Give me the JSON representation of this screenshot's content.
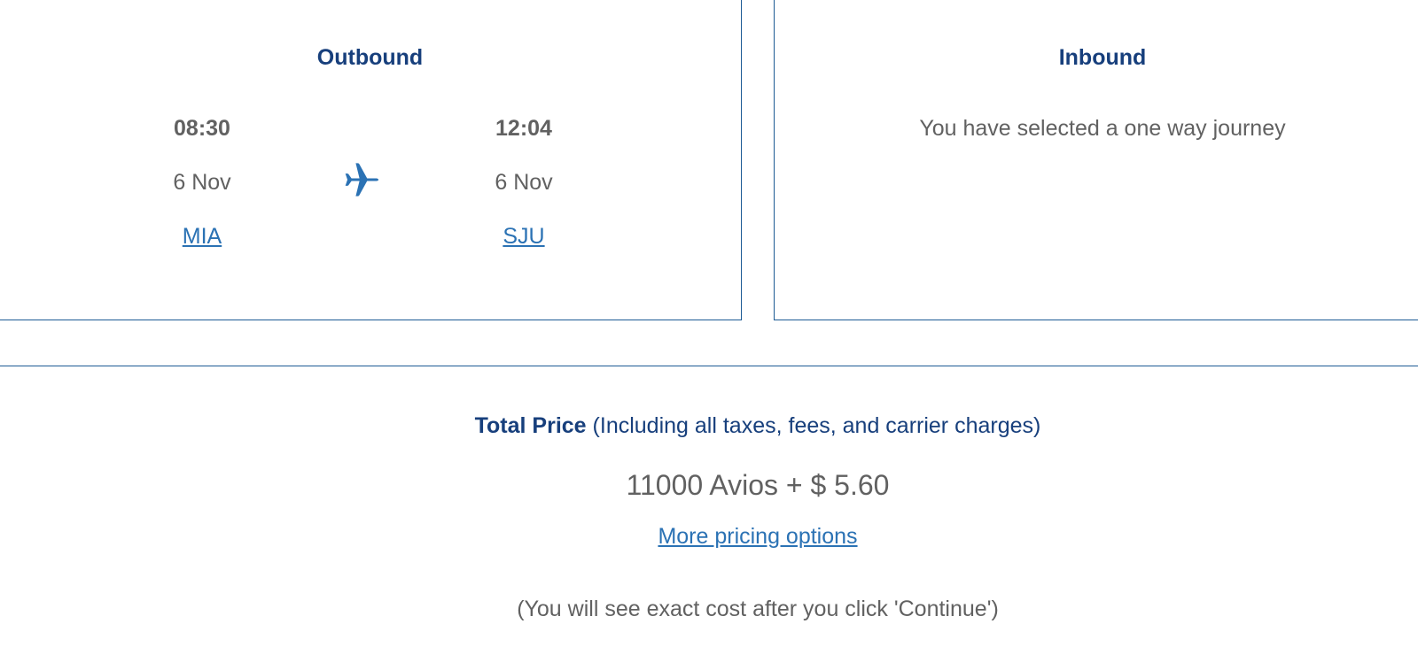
{
  "outbound": {
    "title": "Outbound",
    "departure": {
      "time": "08:30",
      "date": "6 Nov",
      "airport": "MIA"
    },
    "arrival": {
      "time": "12:04",
      "date": "6 Nov",
      "airport": "SJU"
    },
    "icon": "airplane-icon"
  },
  "inbound": {
    "title": "Inbound",
    "message": "You have selected a one way journey"
  },
  "summary": {
    "total_label": "Total Price",
    "total_note": "(Including all taxes, fees, and carrier charges)",
    "price": "11000 Avios + $ 5.60",
    "more_options": "More pricing options",
    "exact_cost_note": "(You will see exact cost after you click 'Continue')"
  },
  "colors": {
    "heading": "#173f7c",
    "link": "#2b72b4",
    "text": "#616161",
    "border": "#1c5a94"
  }
}
